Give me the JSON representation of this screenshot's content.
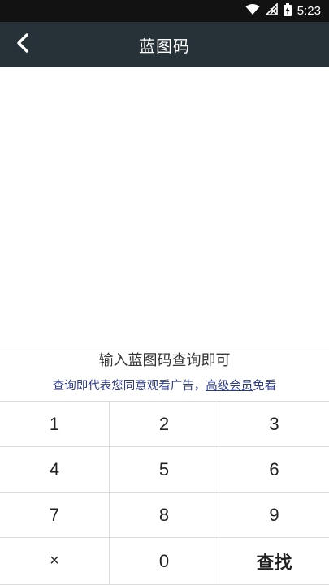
{
  "status_bar": {
    "time": "5:23",
    "icons": [
      "wifi-icon",
      "no-signal-icon",
      "battery-charging-icon"
    ]
  },
  "app_bar": {
    "back_icon": "chevron-left-icon",
    "title": "蓝图码"
  },
  "hint": {
    "main": "输入蓝图码查询即可",
    "sub_prefix": "查询即代表您同意观看广告，",
    "sub_link": "高级会员",
    "sub_suffix": "免看"
  },
  "keypad": {
    "keys": [
      "1",
      "2",
      "3",
      "4",
      "5",
      "6",
      "7",
      "8",
      "9",
      "×",
      "0",
      "查找"
    ]
  },
  "colors": {
    "app_bar_bg": "#263238",
    "status_bar_bg": "#121212",
    "hint_link": "#2c3a8c"
  }
}
